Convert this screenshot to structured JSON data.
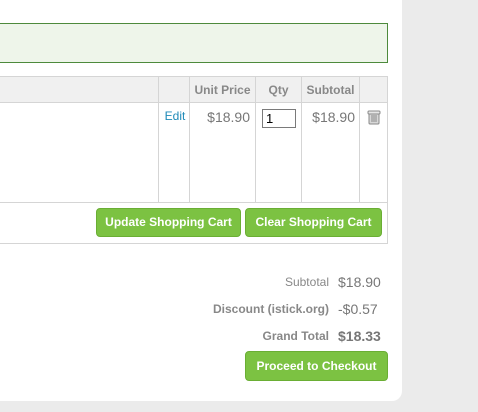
{
  "cart": {
    "headers": {
      "unit_price": "Unit Price",
      "qty": "Qty",
      "subtotal": "Subtotal"
    },
    "item": {
      "edit_label": "Edit",
      "unit_price": "$18.90",
      "qty": "1",
      "subtotal": "$18.90"
    },
    "update_button_label": "Update Shopping Cart",
    "clear_button_label": "Clear Shopping Cart"
  },
  "totals": {
    "subtotal_label": "Subtotal",
    "subtotal_value": "$18.90",
    "discount_label": "Discount (istick.org)",
    "discount_value": "-$0.57",
    "grand_total_label": "Grand Total",
    "grand_total_value": "$18.33"
  },
  "checkout_button_label": "Proceed to Checkout",
  "icons": {
    "remove_item": "trash-icon"
  },
  "colors": {
    "button_green": "#7cc242",
    "link_blue": "#1e8ab8",
    "message_border": "#4d8a3c",
    "message_bg": "#eef5ea"
  }
}
